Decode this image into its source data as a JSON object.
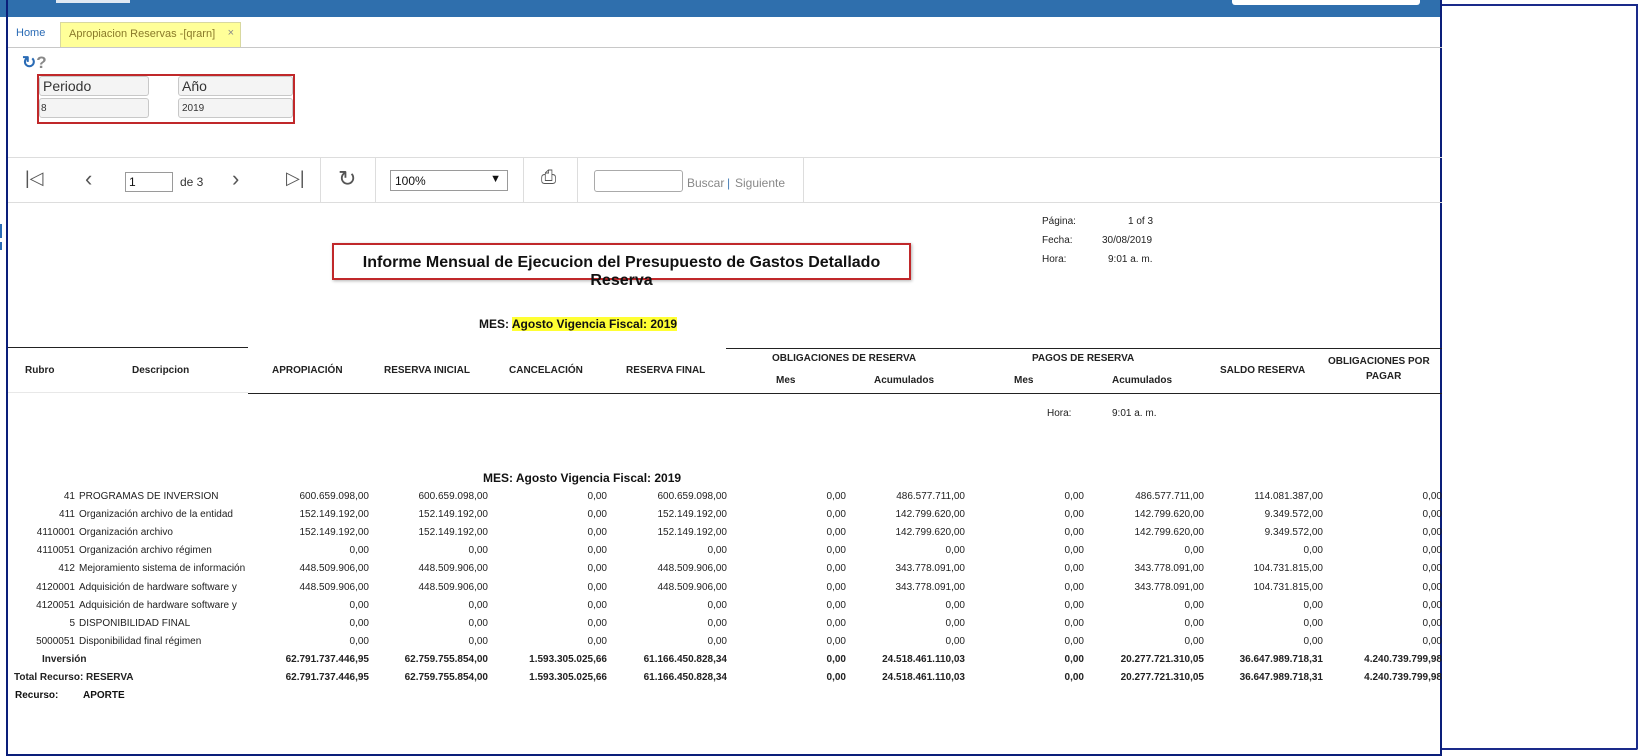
{
  "tabs": {
    "home": "Home",
    "active": "Apropiacion Reservas -[qrarn]",
    "close": "×"
  },
  "toolbar_icons": {
    "refresh": "refresh-icon",
    "help": "help-icon"
  },
  "params": {
    "periodo_label": "Periodo",
    "periodo_value": "8",
    "anio_label": "Año",
    "anio_value": "2019"
  },
  "pager": {
    "page": "1",
    "of": "de 3",
    "zoom": "100%",
    "search_placeholder": "",
    "buscar": "Buscar",
    "sep": "|",
    "siguiente": "Siguiente"
  },
  "report": {
    "title": "Informe Mensual de Ejecucion del Presupuesto de Gastos Detallado Reserva",
    "pagina_label": "Página:",
    "pagina_value": "1 of 3",
    "fecha_label": "Fecha:",
    "fecha_value": "30/08/2019",
    "hora_label": "Hora:",
    "hora_value": "9:01 a. m.",
    "mes_label": "MES:",
    "mes_value": "Agosto  Vigencia Fiscal: 2019",
    "mes_repeat": "MES: Agosto  Vigencia Fiscal: 2019"
  },
  "headers": {
    "rubro": "Rubro",
    "descripcion": "Descripcion",
    "apropiacion": "APROPIACIÓN",
    "reserva_inicial": "RESERVA INICIAL",
    "cancelacion": "CANCELACIÓN",
    "reserva_final": "RESERVA FINAL",
    "obligaciones_reserva": "OBLIGACIONES DE RESERVA",
    "pagos_reserva": "PAGOS DE RESERVA",
    "mes": "Mes",
    "acumulados": "Acumulados",
    "saldo_reserva": "SALDO RESERVA",
    "obligaciones_pagar_1": "OBLIGACIONES POR",
    "obligaciones_pagar_2": "PAGAR"
  },
  "rows": [
    [
      "41",
      "PROGRAMAS DE INVERSION",
      "600.659.098,00",
      "600.659.098,00",
      "0,00",
      "600.659.098,00",
      "0,00",
      "486.577.711,00",
      "0,00",
      "486.577.711,00",
      "114.081.387,00",
      "0,00"
    ],
    [
      "411",
      "Organización archivo de la entidad",
      "152.149.192,00",
      "152.149.192,00",
      "0,00",
      "152.149.192,00",
      "0,00",
      "142.799.620,00",
      "0,00",
      "142.799.620,00",
      "9.349.572,00",
      "0,00"
    ],
    [
      "4110001",
      "Organización archivo",
      "152.149.192,00",
      "152.149.192,00",
      "0,00",
      "152.149.192,00",
      "0,00",
      "142.799.620,00",
      "0,00",
      "142.799.620,00",
      "9.349.572,00",
      "0,00"
    ],
    [
      "4110051",
      "Organización archivo régimen",
      "0,00",
      "0,00",
      "0,00",
      "0,00",
      "0,00",
      "0,00",
      "0,00",
      "0,00",
      "0,00",
      "0,00"
    ],
    [
      "412",
      "Mejoramiento sistema de información",
      "448.509.906,00",
      "448.509.906,00",
      "0,00",
      "448.509.906,00",
      "0,00",
      "343.778.091,00",
      "0,00",
      "343.778.091,00",
      "104.731.815,00",
      "0,00"
    ],
    [
      "4120001",
      "Adquisición de hardware software y",
      "448.509.906,00",
      "448.509.906,00",
      "0,00",
      "448.509.906,00",
      "0,00",
      "343.778.091,00",
      "0,00",
      "343.778.091,00",
      "104.731.815,00",
      "0,00"
    ],
    [
      "4120051",
      "Adquisición de hardware software y",
      "0,00",
      "0,00",
      "0,00",
      "0,00",
      "0,00",
      "0,00",
      "0,00",
      "0,00",
      "0,00",
      "0,00"
    ],
    [
      "5",
      "DISPONIBILIDAD FINAL",
      "0,00",
      "0,00",
      "0,00",
      "0,00",
      "0,00",
      "0,00",
      "0,00",
      "0,00",
      "0,00",
      "0,00"
    ],
    [
      "5000051",
      "Disponibilidad final régimen",
      "0,00",
      "0,00",
      "0,00",
      "0,00",
      "0,00",
      "0,00",
      "0,00",
      "0,00",
      "0,00",
      "0,00"
    ]
  ],
  "totals": [
    [
      "",
      "Inversión",
      "62.791.737.446,95",
      "62.759.755.854,00",
      "1.593.305.025,66",
      "61.166.450.828,34",
      "0,00",
      "24.518.461.110,03",
      "0,00",
      "20.277.721.310,05",
      "36.647.989.718,31",
      "4.240.739.799,98"
    ],
    [
      "Total Recurso: RESERVA",
      "",
      "62.791.737.446,95",
      "62.759.755.854,00",
      "1.593.305.025,66",
      "61.166.450.828,34",
      "0,00",
      "24.518.461.110,03",
      "0,00",
      "20.277.721.310,05",
      "36.647.989.718,31",
      "4.240.739.799,98"
    ]
  ],
  "recurso": {
    "label": "Recurso:",
    "value": "APORTE"
  }
}
